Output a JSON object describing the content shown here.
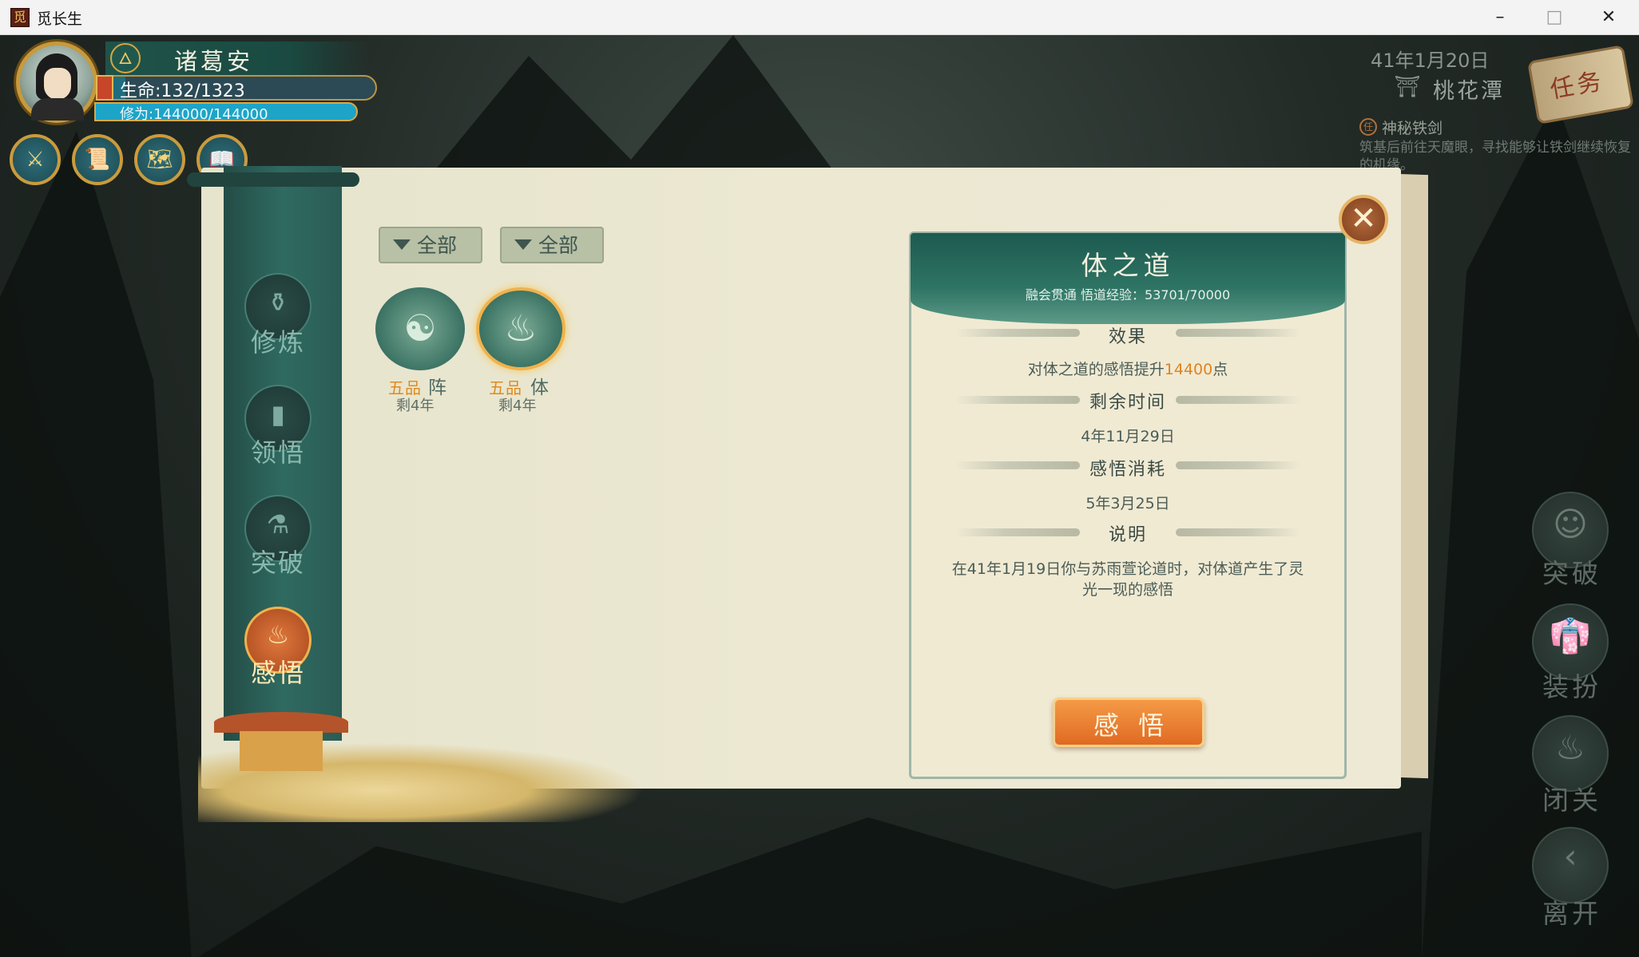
{
  "window": {
    "title": "觅长生",
    "app_icon": "game-app-icon",
    "minimize": "–",
    "maximize": "□",
    "close": "✕"
  },
  "player": {
    "name": "诸葛安",
    "element_icon": "fire-element-icon",
    "hp_label": "生命:132/1323",
    "hp_current": 132,
    "hp_max": 1323,
    "cultivation_label": "修为:144000/144000",
    "cultivation_current": 144000,
    "cultivation_max": 144000
  },
  "quick_icons": [
    "sword-icon",
    "scroll-icon",
    "map-icon",
    "book-icon"
  ],
  "world": {
    "date": "41年1月20日",
    "location": "桃花潭",
    "quest_button": "任务",
    "quest_name": "神秘铁剑",
    "quest_desc": "筑基后前往天魔眼，寻找能够让铁剑继续恢复的机缘。"
  },
  "side_menu": [
    {
      "label": "突破",
      "icon": "bald-monk-icon"
    },
    {
      "label": "装扮",
      "icon": "robe-icon"
    },
    {
      "label": "闭关",
      "icon": "incense-burner-icon"
    },
    {
      "label": "离开",
      "icon": "back-arrow-icon"
    }
  ],
  "tabs": [
    {
      "label": "修炼",
      "icon": "gourd-icon",
      "active": false
    },
    {
      "label": "领悟",
      "icon": "book-icon",
      "active": false
    },
    {
      "label": "突破",
      "icon": "bottle-icon",
      "active": false
    },
    {
      "label": "感悟",
      "icon": "incense-burner-icon",
      "active": true
    }
  ],
  "filters": [
    "全部",
    "全部"
  ],
  "insights": [
    {
      "glyph": "☯",
      "grade": "五品",
      "type": "阵",
      "remaining": "剩4年",
      "selected": false
    },
    {
      "glyph": "♨",
      "grade": "五品",
      "type": "体",
      "remaining": "剩4年",
      "selected": true
    }
  ],
  "detail": {
    "title": "体之道",
    "subtitle": "融会贯通  悟道经验：53701/70000",
    "effect_title": "效果",
    "effect_prefix": "对体之道的感悟提升",
    "effect_value": "14400",
    "effect_suffix": "点",
    "remaining_title": "剩余时间",
    "remaining_value": "4年11月29日",
    "cost_title": "感悟消耗",
    "cost_value": "5年3月25日",
    "desc_title": "说明",
    "desc": "在41年1月19日你与苏雨萱论道时，对体道产生了灵光一现的感悟",
    "button": "感悟"
  },
  "close_label": "✕"
}
